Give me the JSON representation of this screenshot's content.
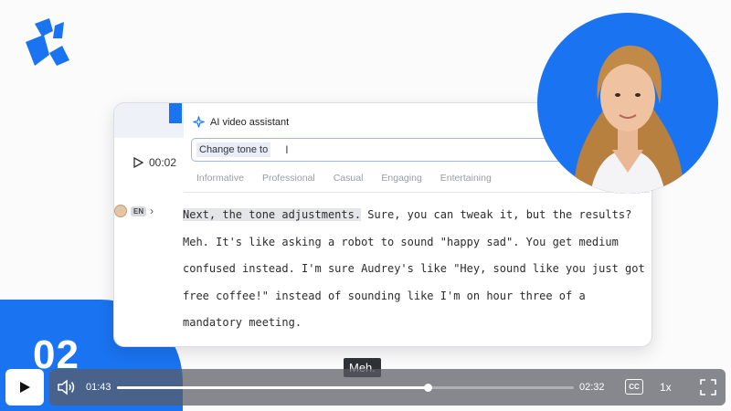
{
  "slide": {
    "number": "02"
  },
  "editor": {
    "timecode": "00:02",
    "speaker_lang": "EN",
    "assistant": {
      "title": "AI video assistant",
      "input_value": "Change tone to",
      "tones": [
        "Informative",
        "Professional",
        "Casual",
        "Engaging",
        "Entertaining"
      ]
    },
    "transcript": {
      "highlight": "Next, the tone adjustments.",
      "rest": " Sure, you can tweak it, but the results? Meh. It's like asking a robot to sound \"happy sad\". You get medium confused instead. I'm sure Audrey's like \"Hey, sound like you just got free coffee!\" instead of sounding like I'm on hour three of a mandatory meeting."
    }
  },
  "caption": "Meh.",
  "player": {
    "current_time": "01:43",
    "total_time": "02:32",
    "progress": 0.68,
    "cc_label": "CC",
    "speed": "1x"
  },
  "colors": {
    "accent": "#1a73f0"
  }
}
